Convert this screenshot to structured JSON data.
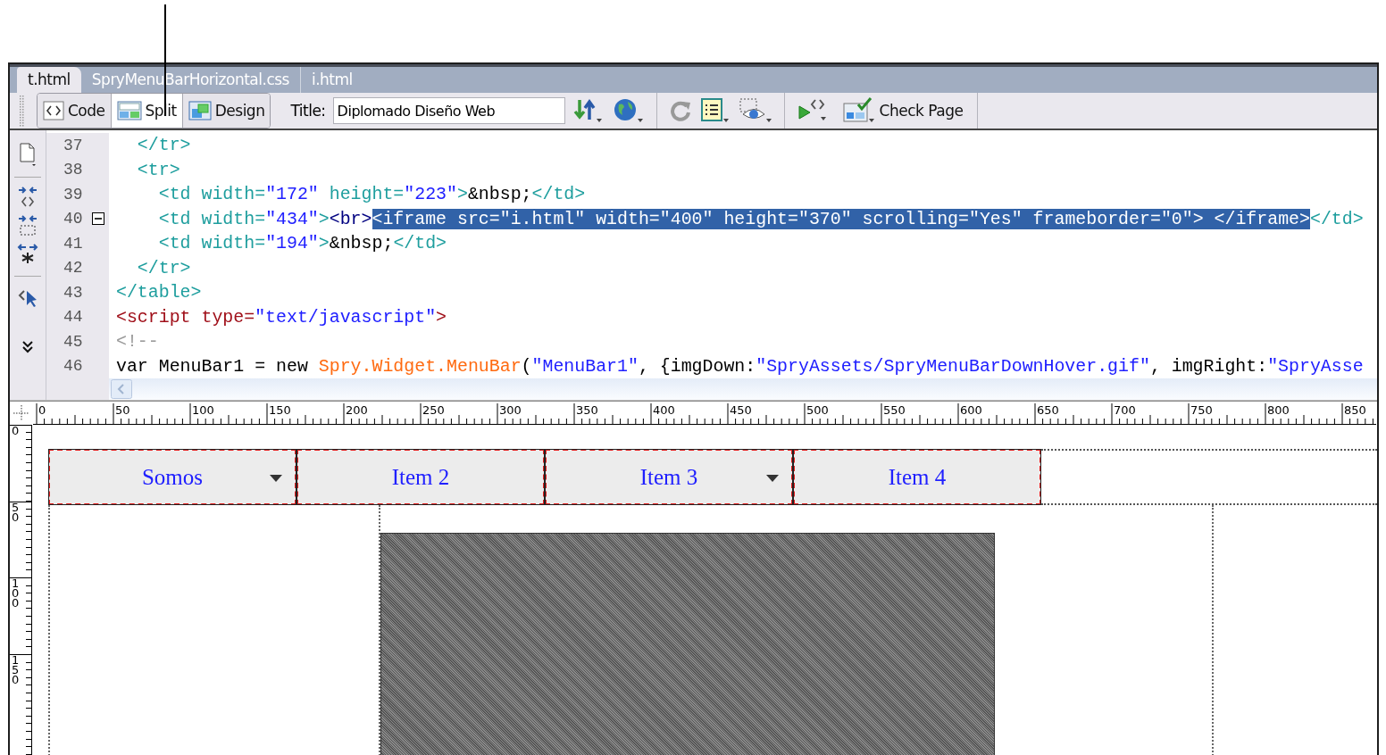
{
  "tabs": [
    {
      "label": "t.html",
      "selected": true
    },
    {
      "label": "SpryMenuBarHorizontal.css",
      "selected": false
    },
    {
      "label": "i.html",
      "selected": false
    }
  ],
  "toolbar": {
    "view_buttons": [
      {
        "label": "Code",
        "kind": "code",
        "selected": false
      },
      {
        "label": "Split",
        "kind": "split",
        "selected": true
      },
      {
        "label": "Design",
        "kind": "design",
        "selected": false
      }
    ],
    "title_label": "Title:",
    "title_value": "Diplomado Diseño Web",
    "check_page": "Check Page"
  },
  "code_view": {
    "lines": [
      {
        "number": "37",
        "fold_marker": false,
        "segments": [
          {
            "selected": false,
            "tokens": [
              {
                "kind": "tag",
                "text": "  </tr>"
              }
            ]
          }
        ]
      },
      {
        "number": "38",
        "fold_marker": false,
        "segments": [
          {
            "selected": false,
            "tokens": [
              {
                "kind": "tag",
                "text": "  <tr>"
              }
            ]
          }
        ]
      },
      {
        "number": "39",
        "fold_marker": false,
        "segments": [
          {
            "selected": false,
            "tokens": [
              {
                "kind": "tag",
                "text": "    <td "
              },
              {
                "kind": "attr",
                "text": "width="
              },
              {
                "kind": "value",
                "text": "\"172\""
              },
              {
                "kind": "attr",
                "text": " height="
              },
              {
                "kind": "value",
                "text": "\"223\""
              },
              {
                "kind": "tag",
                "text": ">"
              },
              {
                "kind": "entity",
                "text": "&nbsp;"
              },
              {
                "kind": "tag",
                "text": "</td>"
              }
            ]
          }
        ]
      },
      {
        "number": "40",
        "fold_marker": true,
        "segments": [
          {
            "selected": false,
            "tokens": [
              {
                "kind": "tag",
                "text": "    <td "
              },
              {
                "kind": "attr",
                "text": "width="
              },
              {
                "kind": "value",
                "text": "\"434\""
              },
              {
                "kind": "tag",
                "text": ">"
              },
              {
                "kind": "br",
                "text": "<br>"
              }
            ]
          },
          {
            "selected": true,
            "tokens": [
              {
                "kind": "tag",
                "text": "<iframe "
              },
              {
                "kind": "attr",
                "text": "src="
              },
              {
                "kind": "value",
                "text": "\"i.html\""
              },
              {
                "kind": "attr",
                "text": " width="
              },
              {
                "kind": "value",
                "text": "\"400\""
              },
              {
                "kind": "attr",
                "text": " height="
              },
              {
                "kind": "value",
                "text": "\"370\""
              },
              {
                "kind": "attr",
                "text": " scrolling="
              },
              {
                "kind": "value",
                "text": "\"Yes\""
              },
              {
                "kind": "attr",
                "text": " frameborder="
              },
              {
                "kind": "value",
                "text": "\"0\""
              },
              {
                "kind": "tag",
                "text": "> </iframe>"
              }
            ]
          },
          {
            "selected": false,
            "tokens": [
              {
                "kind": "tag",
                "text": "</td>"
              }
            ]
          }
        ]
      },
      {
        "number": "41",
        "fold_marker": false,
        "segments": [
          {
            "selected": false,
            "tokens": [
              {
                "kind": "tag",
                "text": "    <td "
              },
              {
                "kind": "attr",
                "text": "width="
              },
              {
                "kind": "value",
                "text": "\"194\""
              },
              {
                "kind": "tag",
                "text": ">"
              },
              {
                "kind": "entity",
                "text": "&nbsp;"
              },
              {
                "kind": "tag",
                "text": "</td>"
              }
            ]
          }
        ]
      },
      {
        "number": "42",
        "fold_marker": false,
        "segments": [
          {
            "selected": false,
            "tokens": [
              {
                "kind": "tag",
                "text": "  </tr>"
              }
            ]
          }
        ]
      },
      {
        "number": "43",
        "fold_marker": false,
        "segments": [
          {
            "selected": false,
            "tokens": [
              {
                "kind": "tag",
                "text": "</table>"
              }
            ]
          }
        ]
      },
      {
        "number": "44",
        "fold_marker": false,
        "segments": [
          {
            "selected": false,
            "tokens": [
              {
                "kind": "script",
                "text": "<script type="
              },
              {
                "kind": "value",
                "text": "\"text/javascript\""
              },
              {
                "kind": "script",
                "text": ">"
              }
            ]
          }
        ]
      },
      {
        "number": "45",
        "fold_marker": false,
        "segments": [
          {
            "selected": false,
            "tokens": [
              {
                "kind": "comment",
                "text": "<!--"
              }
            ]
          }
        ]
      },
      {
        "number": "46",
        "fold_marker": false,
        "segments": [
          {
            "selected": false,
            "tokens": [
              {
                "kind": "plain",
                "text": "var MenuBar1 = new "
              },
              {
                "kind": "func",
                "text": "Spry.Widget.MenuBar"
              },
              {
                "kind": "plain",
                "text": "("
              },
              {
                "kind": "value",
                "text": "\"MenuBar1\""
              },
              {
                "kind": "plain",
                "text": ", {imgDown:"
              },
              {
                "kind": "value",
                "text": "\"SpryAssets/SpryMenuBarDownHover.gif\""
              },
              {
                "kind": "plain",
                "text": ", imgRight:"
              },
              {
                "kind": "value",
                "text": "\"SpryAsse"
              }
            ]
          }
        ]
      }
    ]
  },
  "rulers": {
    "horizontal": [
      "0",
      "50",
      "100",
      "150",
      "200",
      "250",
      "300",
      "350",
      "400",
      "450",
      "500",
      "550",
      "600",
      "650",
      "700",
      "750",
      "800",
      "850"
    ],
    "vertical": [
      "0",
      "50",
      "100",
      "150"
    ]
  },
  "design_view": {
    "menu_items": [
      {
        "label": "Somos",
        "has_submenu": true
      },
      {
        "label": "Item 2",
        "has_submenu": false
      },
      {
        "label": "Item 3",
        "has_submenu": true
      },
      {
        "label": "Item 4",
        "has_submenu": false
      }
    ]
  }
}
